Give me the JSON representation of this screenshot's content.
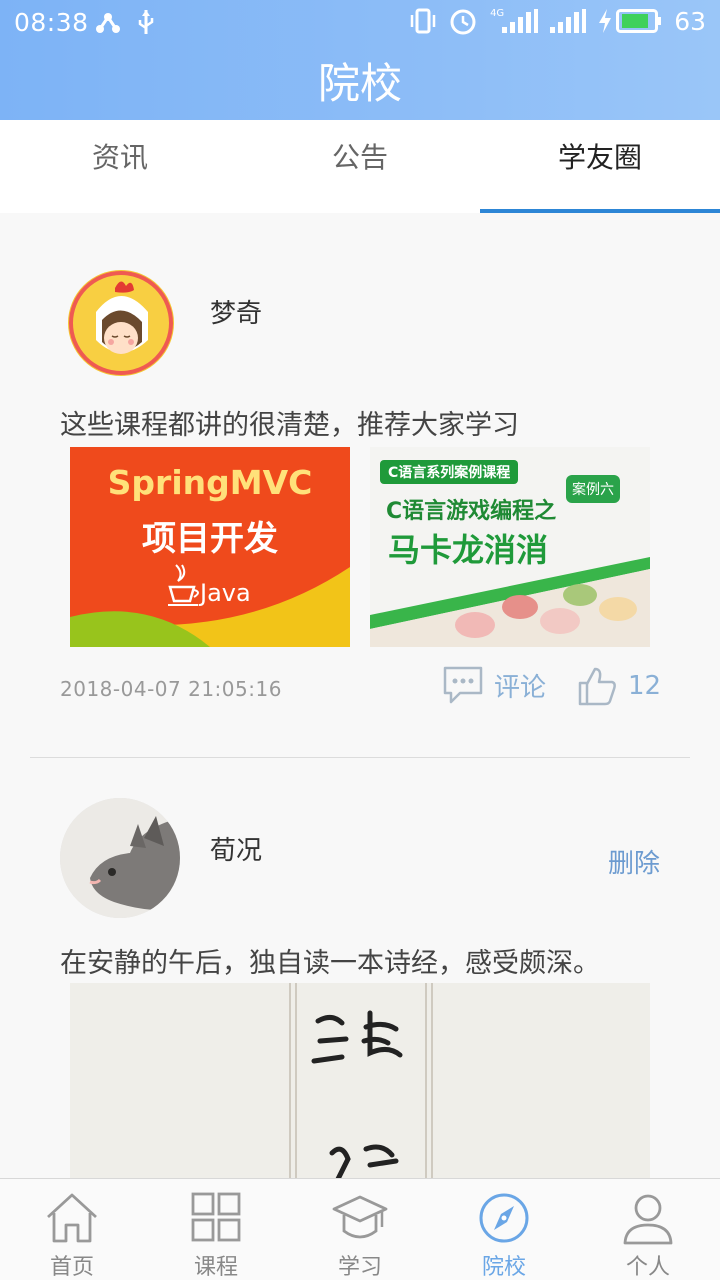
{
  "status_bar": {
    "time": "08:38",
    "battery_level": "63",
    "network": "4G"
  },
  "header": {
    "title": "院校"
  },
  "tabs": [
    {
      "label": "资讯",
      "active": false
    },
    {
      "label": "公告",
      "active": false
    },
    {
      "label": "学友圈",
      "active": true
    }
  ],
  "posts": [
    {
      "username": "梦奇",
      "text": "这些课程都讲的很清楚，推荐大家学习",
      "images": [
        {
          "line1": "SpringMVC",
          "line2": "项目开发",
          "brand": "Java"
        },
        {
          "tag": "C语言系列案例课程",
          "badge": "案例六",
          "line1": "C语言游戏编程之",
          "line2": "马卡龙消消"
        }
      ],
      "time": "2018-04-07 21:05:16",
      "comment_label": "评论",
      "like_count": "12"
    },
    {
      "username": "荀况",
      "delete_label": "删除",
      "text": "在安静的午后，独自读一本诗经，感受颇深。"
    }
  ],
  "bottom_nav": [
    {
      "label": "首页",
      "icon": "home-icon"
    },
    {
      "label": "课程",
      "icon": "grid-icon"
    },
    {
      "label": "学习",
      "icon": "graduation-cap-icon"
    },
    {
      "label": "院校",
      "icon": "compass-icon",
      "active": true
    },
    {
      "label": "个人",
      "icon": "person-icon"
    }
  ],
  "colors": {
    "header": "#8dbdf7",
    "accent": "#2d86d6",
    "link": "#6c9bd0",
    "nav_active": "#6aa6e6"
  }
}
